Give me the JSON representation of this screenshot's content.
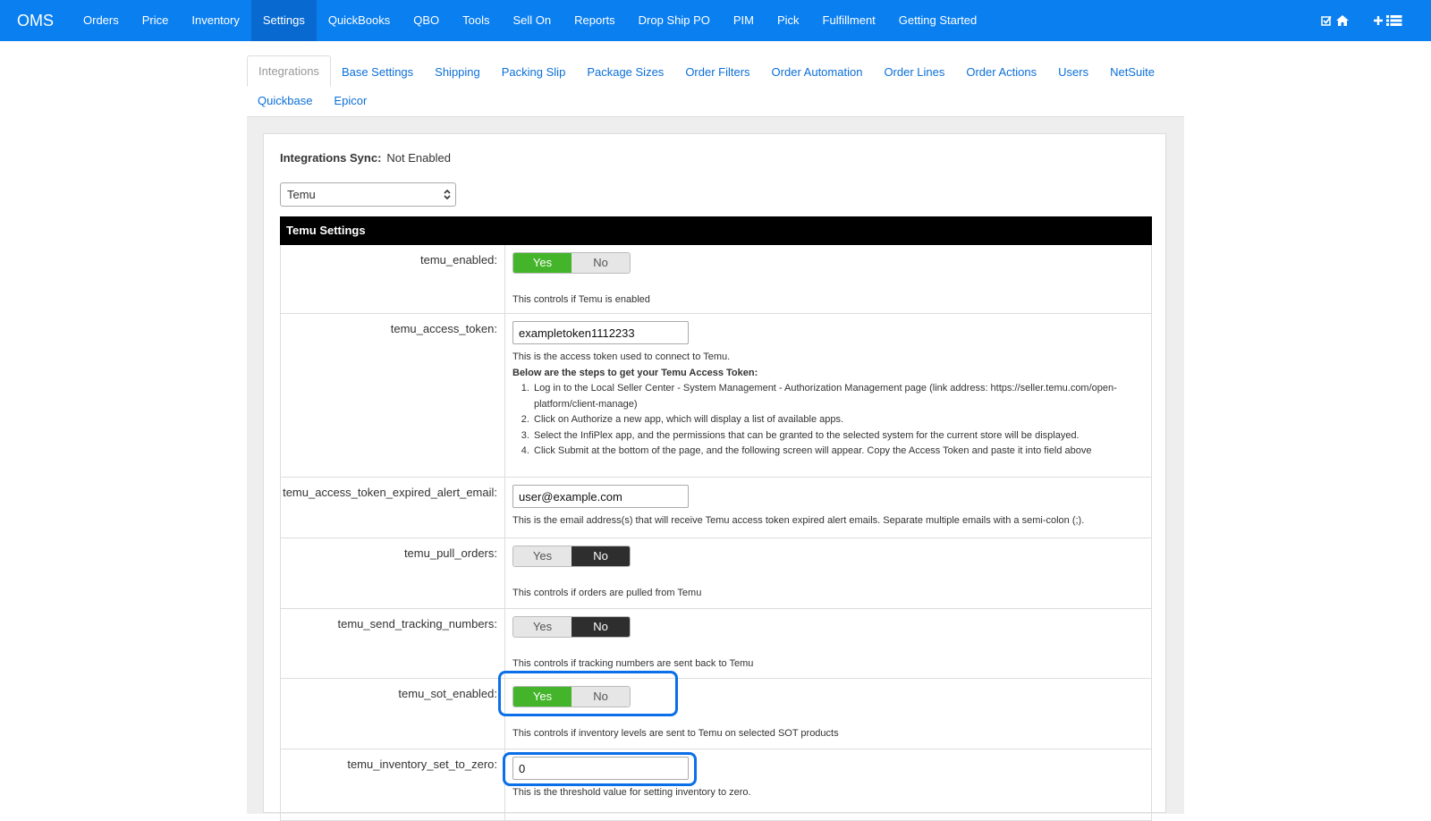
{
  "nav": {
    "brand": "OMS",
    "items": [
      "Orders",
      "Price",
      "Inventory",
      "Settings",
      "QuickBooks",
      "QBO",
      "Tools",
      "Sell On",
      "Reports",
      "Drop Ship PO",
      "PIM",
      "Pick",
      "Fulfillment",
      "Getting Started"
    ],
    "active": "Settings",
    "right_icons": [
      "check-square-icon",
      "home-icon",
      "plus-icon",
      "list-icon"
    ]
  },
  "tabs": {
    "row1": [
      "Integrations",
      "Base Settings",
      "Shipping",
      "Packing Slip",
      "Package Sizes",
      "Order Filters",
      "Order Automation",
      "Order Lines",
      "Order Actions",
      "Users",
      "NetSuite"
    ],
    "row2": [
      "Quickbase",
      "Epicor"
    ],
    "active": "Integrations"
  },
  "sync": {
    "label": "Integrations Sync:",
    "value": "Not Enabled"
  },
  "integration_select": {
    "value": "Temu"
  },
  "section_title": "Temu Settings",
  "toggle_labels": {
    "yes": "Yes",
    "no": "No"
  },
  "settings": {
    "enabled": {
      "label": "temu_enabled:",
      "value": "Yes",
      "help": "This controls if Temu is enabled"
    },
    "access_token": {
      "label": "temu_access_token:",
      "value": "exampletoken1112233",
      "help": "This is the access token used to connect to Temu.",
      "steps_title": "Below are the steps to get your Temu Access Token:",
      "steps": [
        "Log in to the Local Seller Center - System Management - Authorization Management page (link address: https://seller.temu.com/open-platform/client-manage)",
        "Click on Authorize a new app, which will display a list of available apps.",
        "Select the InfiPlex app, and the permissions that can be granted to the selected system for the current store will be displayed.",
        "Click Submit at the bottom of the page, and the following screen will appear. Copy the Access Token and paste it into field above"
      ]
    },
    "alert_email": {
      "label": "temu_access_token_expired_alert_email:",
      "value": "user@example.com",
      "help": "This is the email address(s) that will receive Temu access token expired alert emails. Separate multiple emails with a semi-colon (;)."
    },
    "pull_orders": {
      "label": "temu_pull_orders:",
      "value": "No",
      "help": "This controls if orders are pulled from Temu"
    },
    "send_tracking": {
      "label": "temu_send_tracking_numbers:",
      "value": "No",
      "help": "This controls if tracking numbers are sent back to Temu"
    },
    "sot_enabled": {
      "label": "temu_sot_enabled:",
      "value": "Yes",
      "help": "This controls if inventory levels are sent to Temu on selected SOT products"
    },
    "inventory_zero": {
      "label": "temu_inventory_set_to_zero:",
      "value": "0",
      "help": "This is the threshold value for setting inventory to zero."
    }
  },
  "colors": {
    "nav": "#0a7ff0",
    "yes_on": "#44b52a",
    "no_on": "#2e2e2e",
    "highlight": "#0a6fe8"
  }
}
